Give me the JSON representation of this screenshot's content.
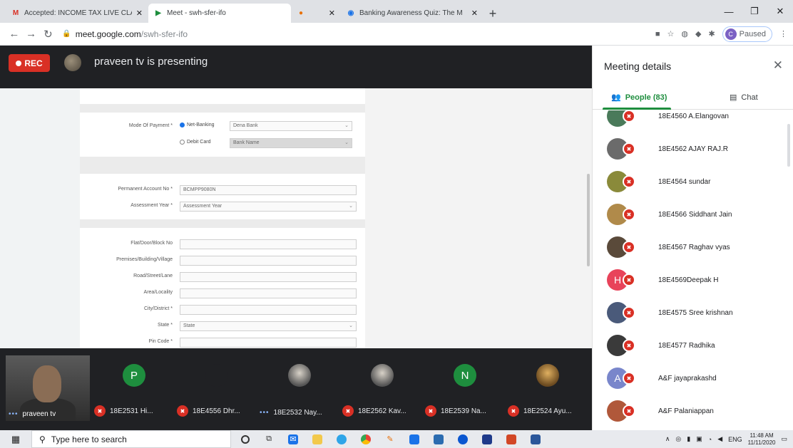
{
  "browser": {
    "tabs": [
      {
        "title": "Accepted: INCOME TAX LIVE CLA",
        "favicon": "gmail-icon",
        "color": "#d93025"
      },
      {
        "title": "Meet - swh-sfer-ifo",
        "favicon": "meet-icon",
        "color": "#1e8e3e"
      },
      {
        "title": "",
        "favicon": "tab-favicon-icon",
        "color": "#e8710a"
      },
      {
        "title": "Banking Awareness Quiz: The M",
        "favicon": "quiz-icon",
        "color": "#1a73e8"
      }
    ],
    "address": {
      "host": "meet.google.com",
      "path": "/swh-sfer-ifo"
    },
    "profile": {
      "initial": "C",
      "status": "Paused"
    }
  },
  "meeting": {
    "rec_label": "REC",
    "presenting_text": "praveen tv is presenting"
  },
  "shared_form": {
    "mode_of_payment_label": "Mode Of Payment *",
    "net_banking": "Net-Banking",
    "debit_card": "Debit Card",
    "bank_select_1": "Dena Bank",
    "bank_select_2": "Bank Name",
    "pan_label": "Permanent Account No *",
    "pan_value": "BCMPP9080N",
    "assessment_label": "Assessment Year *",
    "assessment_value": "Assessment Year",
    "flat_label": "Flat/Door/Block No",
    "premises_label": "Premises/Building/Village",
    "road_label": "Road/Street/Lane",
    "area_label": "Area/Locality",
    "city_label": "City/District *",
    "state_label": "State *",
    "state_value": "State",
    "pin_label": "Pin Code *"
  },
  "strip": {
    "self_name": "praveen tv",
    "tiles": [
      {
        "initial": "P",
        "name": "18E2531 Hi...",
        "color": "#1e8e3e"
      },
      {
        "initial": "",
        "name": "18E4556 Dhr...",
        "color": "#202124"
      },
      {
        "initial": "",
        "name": "18E2532 Nay...",
        "color": "#202124"
      },
      {
        "initial": "",
        "name": "18E2562 Kav...",
        "color": "#202124"
      },
      {
        "initial": "N",
        "name": "18E2539 Na...",
        "color": "#1e8e3e"
      },
      {
        "initial": "",
        "name": "18E2524 Ayu...",
        "color": "#202124"
      }
    ]
  },
  "side_panel": {
    "title": "Meeting details",
    "people_tab": "People (83)",
    "chat_tab": "Chat",
    "people": [
      {
        "name": "18E4560 A.Elangovan",
        "initial": "",
        "color": "#4a7a5a"
      },
      {
        "name": "18E4562 AJAY RAJ.R",
        "initial": "",
        "color": "#6b6b6b"
      },
      {
        "name": "18E4564 sundar",
        "initial": "",
        "color": "#8a8a3a"
      },
      {
        "name": "18E4566 Siddhant Jain",
        "initial": "",
        "color": "#b08a4a"
      },
      {
        "name": "18E4567 Raghav vyas",
        "initial": "",
        "color": "#5a4a3a"
      },
      {
        "name": "18E4569Deepak H",
        "initial": "H",
        "color": "#e8435a"
      },
      {
        "name": "18E4575 Sree krishnan",
        "initial": "",
        "color": "#4a5a7a"
      },
      {
        "name": "18E4577 Radhika",
        "initial": "",
        "color": "#3a3a3a"
      },
      {
        "name": "A&F jayaprakashd",
        "initial": "A",
        "color": "#7986cb"
      },
      {
        "name": "A&F Palaniappan",
        "initial": "",
        "color": "#b0583a"
      }
    ]
  },
  "taskbar": {
    "search_placeholder": "Type here to search",
    "lang": "ENG",
    "time": "11:48 AM",
    "date": "11/11/2020"
  }
}
